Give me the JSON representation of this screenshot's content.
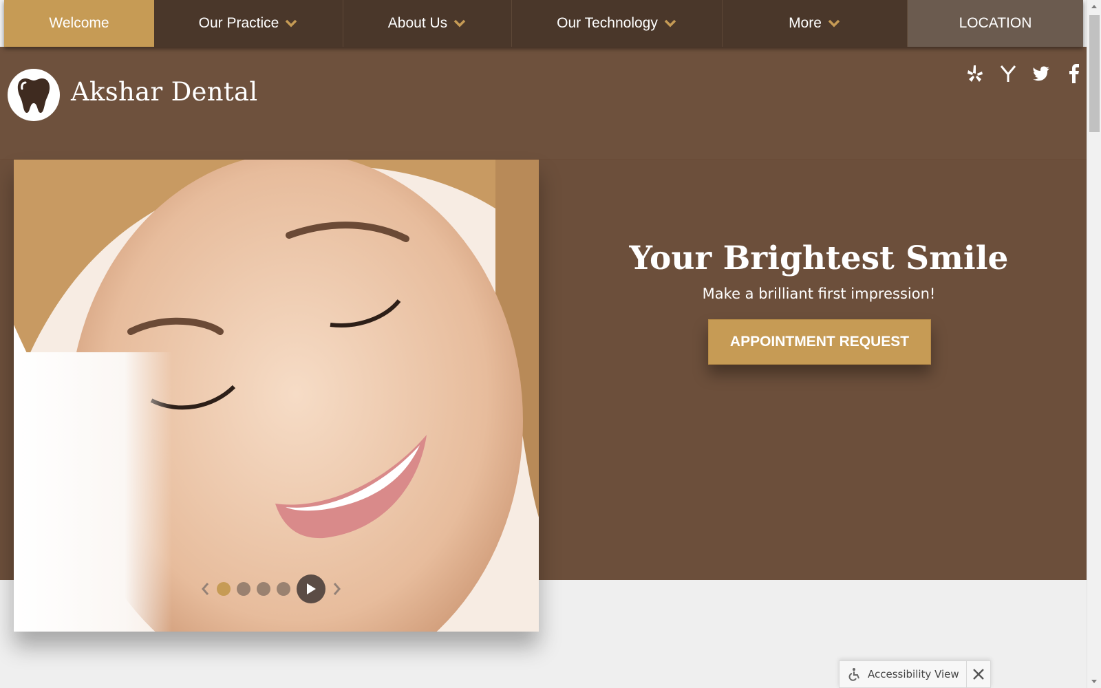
{
  "nav": {
    "items": [
      {
        "label": "Welcome",
        "has_dropdown": false,
        "active": true
      },
      {
        "label": "Our Practice",
        "has_dropdown": true
      },
      {
        "label": "About Us",
        "has_dropdown": true
      },
      {
        "label": "Our Technology",
        "has_dropdown": true
      },
      {
        "label": "More",
        "has_dropdown": true
      }
    ],
    "location_label": "LOCATION"
  },
  "brand": {
    "name": "Akshar Dental",
    "logo_icon": "tooth-icon"
  },
  "social": [
    {
      "icon": "yelp-icon"
    },
    {
      "icon": "yahoo-icon"
    },
    {
      "icon": "twitter-icon"
    },
    {
      "icon": "facebook-icon"
    }
  ],
  "hero": {
    "title": "Your Brightest Smile",
    "subtitle": "Make a brilliant first impression!",
    "cta_label": "APPOINTMENT REQUEST",
    "image_subject": "smiling-woman-photo"
  },
  "slider": {
    "slide_count": 4,
    "active_slide": 1
  },
  "accessibility": {
    "label": "Accessibility View"
  },
  "colors": {
    "accent_gold": "#c69b55",
    "nav_brown": "#4a372a",
    "hero_brown": "#6c4f3b",
    "location_bg": "#6b5b4f"
  }
}
